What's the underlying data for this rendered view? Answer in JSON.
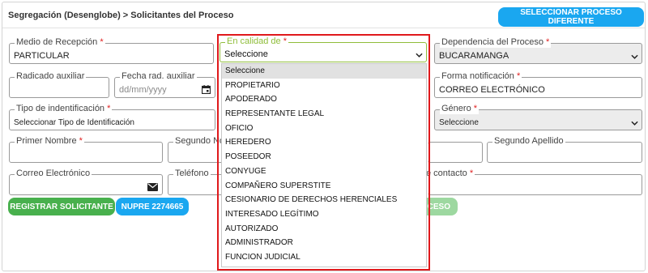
{
  "header": {
    "title": "Segregación (Desenglobe) > Solicitantes del Proceso",
    "select_process_button": "SELECCIONAR PROCESO DIFERENTE"
  },
  "form": {
    "medio_recepcion": {
      "label": "Medio de Recepción",
      "required": "*",
      "value": "PARTICULAR"
    },
    "en_calidad_de": {
      "label": "En calidad de",
      "required": "*",
      "value": "Seleccione"
    },
    "dependencia": {
      "label": "Dependencia del Proceso",
      "required": "*",
      "value": "BUCARAMANGA"
    },
    "radicado_auxiliar": {
      "label": "Radicado auxiliar",
      "value": ""
    },
    "fecha_rad_auxiliar": {
      "label": "Fecha rad. auxiliar",
      "placeholder": "dd/mm/yyyy"
    },
    "forma_notificacion": {
      "label": "Forma notificación",
      "required": "*",
      "value": "CORREO ELECTRÓNICO"
    },
    "tipo_identificacion": {
      "label": "Tipo de indentificación",
      "required": "*",
      "value": "Seleccionar Tipo de Identificación"
    },
    "genero": {
      "label": "Género",
      "required": "*",
      "value": "Seleccione"
    },
    "primer_nombre": {
      "label": "Primer Nombre",
      "required": "*",
      "value": ""
    },
    "segundo_nombre": {
      "label": "Segundo No",
      "value": ""
    },
    "segundo_apellido": {
      "label": "Segundo Apellido",
      "value": ""
    },
    "correo": {
      "label": "Correo Electrónico",
      "value": ""
    },
    "telefono": {
      "label": "Teléfono",
      "value": ""
    },
    "contacto": {
      "label": "e contacto",
      "required": "*",
      "value": ""
    }
  },
  "buttons": {
    "registrar": "REGISTRAR SOLICITANTE",
    "nupre": "NUPRE 2274665",
    "proceso_partial": "ROCESO"
  },
  "dropdown": {
    "options": [
      "Seleccione",
      "PROPIETARIO",
      "APODERADO",
      "REPRESENTANTE LEGAL",
      "OFICIO",
      "HEREDERO",
      "POSEEDOR",
      "CONYUGE",
      "COMPAÑERO SUPERSTITE",
      "CESIONARIO DE DERECHOS HERENCIALES",
      "INTERESADO LEGÍTIMO",
      "AUTORIZADO",
      "ADMINISTRADOR",
      "FUNCION JUDICIAL"
    ],
    "selected_index": 0
  },
  "colors": {
    "primary_blue": "#1aa7f0",
    "green": "#48b04d",
    "highlight_red": "#e0191c",
    "focus_green": "#8fbd3a"
  }
}
